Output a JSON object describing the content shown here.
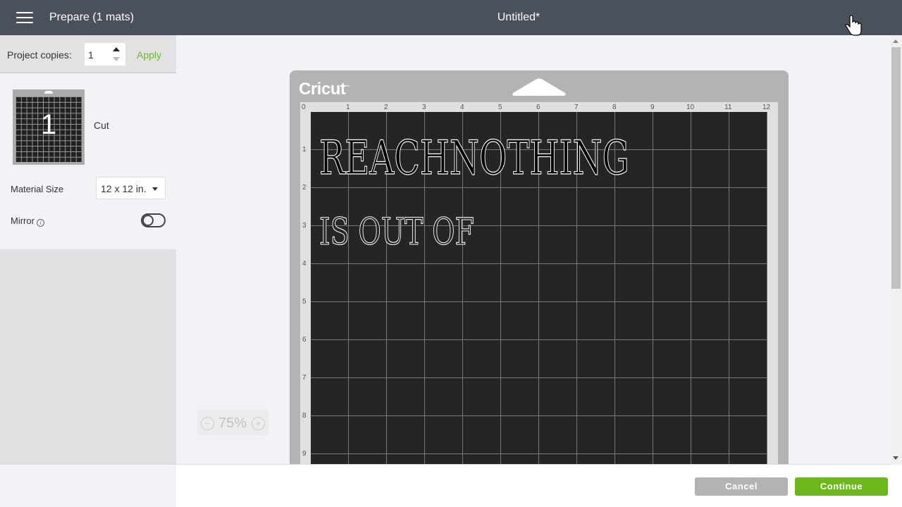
{
  "header": {
    "menu_icon": "hamburger-menu-icon",
    "prepare_title": "Prepare (1 mats)",
    "document_title": "Untitled*"
  },
  "sidebar": {
    "project_copies_label": "Project copies:",
    "project_copies_value": "1",
    "apply_label": "Apply",
    "mat": {
      "number": "1",
      "mode": "Cut"
    },
    "material_size_label": "Material Size",
    "material_size_value": "12 x 12 in.",
    "mirror_label": "Mirror",
    "mirror_on": false
  },
  "canvas": {
    "brand_logo": "Cricut",
    "ruler_x": [
      "0",
      "1",
      "2",
      "3",
      "4",
      "5",
      "6",
      "7",
      "8",
      "9",
      "10",
      "11",
      "12"
    ],
    "ruler_y": [
      "1",
      "2",
      "3",
      "4",
      "5",
      "6",
      "7",
      "8",
      "9"
    ],
    "design_lines": [
      "REACHNOTHING",
      "IS OUT OF"
    ],
    "zoom_level": "75%"
  },
  "footer": {
    "cancel_label": "Cancel",
    "continue_label": "Continue"
  },
  "colors": {
    "header_bg": "#4a515b",
    "accent_green": "#6db719",
    "apply_green": "#6bb42a",
    "mat_grid": "#252525",
    "mat_frame": "#b3b3b3"
  }
}
